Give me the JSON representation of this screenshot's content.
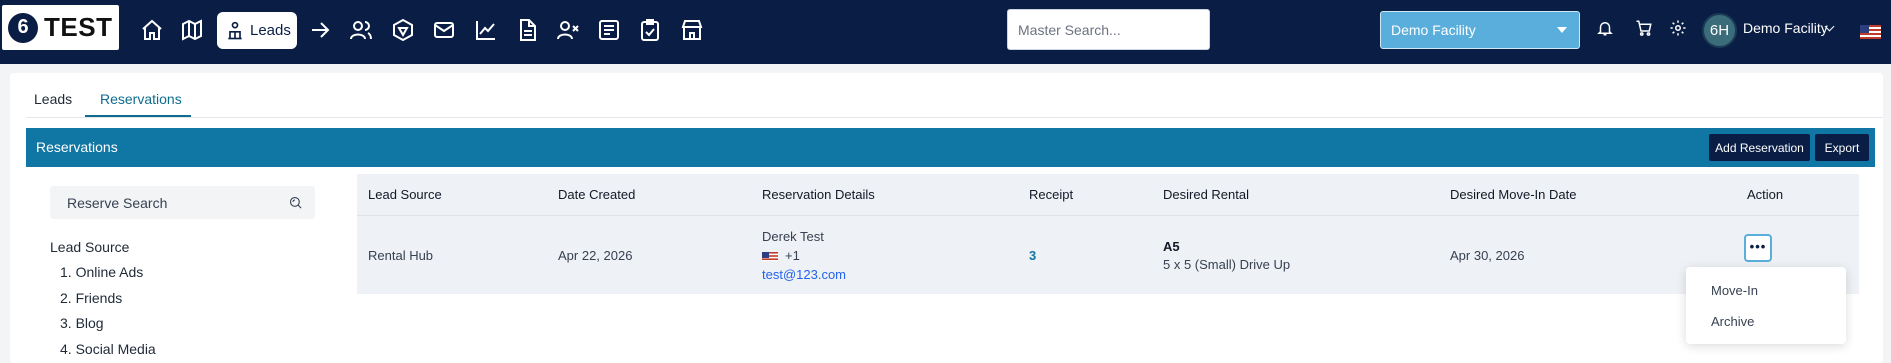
{
  "logo": {
    "number": "6",
    "text": "TEST"
  },
  "nav": {
    "leads_label": "Leads",
    "icons": [
      "home-icon",
      "map-icon",
      "leads-icon",
      "arrow-right-icon",
      "users-icon",
      "hexagon-icon",
      "mail-icon",
      "chart-line-icon",
      "document-icon",
      "user-x-icon",
      "list-icon",
      "clipboard-check-icon",
      "store-icon"
    ]
  },
  "master_search": {
    "placeholder": "Master Search..."
  },
  "facility_select": {
    "value": "Demo Facility"
  },
  "user": {
    "initials": "6H",
    "name": "Demo Facility"
  },
  "tabs": [
    {
      "label": "Leads",
      "active": false
    },
    {
      "label": "Reservations",
      "active": true
    }
  ],
  "reservations_header": {
    "title": "Reservations",
    "add_button": "Add Reservation",
    "export_button": "Export"
  },
  "filters": {
    "search_placeholder": "Reserve Search",
    "lead_source_title": "Lead Source",
    "lead_sources": [
      "1. Online Ads",
      "2. Friends",
      "3. Blog",
      "4. Social Media"
    ]
  },
  "table": {
    "columns": [
      "Lead Source",
      "Date Created",
      "Reservation Details",
      "Receipt",
      "Desired Rental",
      "Desired Move-In Date",
      "Action"
    ],
    "rows": [
      {
        "lead_source": "Rental Hub",
        "date_created": "Apr 22, 2026",
        "name": "Derek Test",
        "phone": "+1",
        "email": "test@123.com",
        "receipt": "3",
        "unit": "A5",
        "unit_desc": "5 x 5 (Small) Drive Up",
        "move_in": "Apr 30, 2026"
      }
    ]
  },
  "action_menu": {
    "button": "•••",
    "items": [
      "Move-In",
      "Archive"
    ]
  },
  "colors": {
    "nav_bg": "#0a1e45",
    "header_blue": "#1076a3",
    "facility_blue": "#5aaedc",
    "link_blue": "#2563eb"
  }
}
